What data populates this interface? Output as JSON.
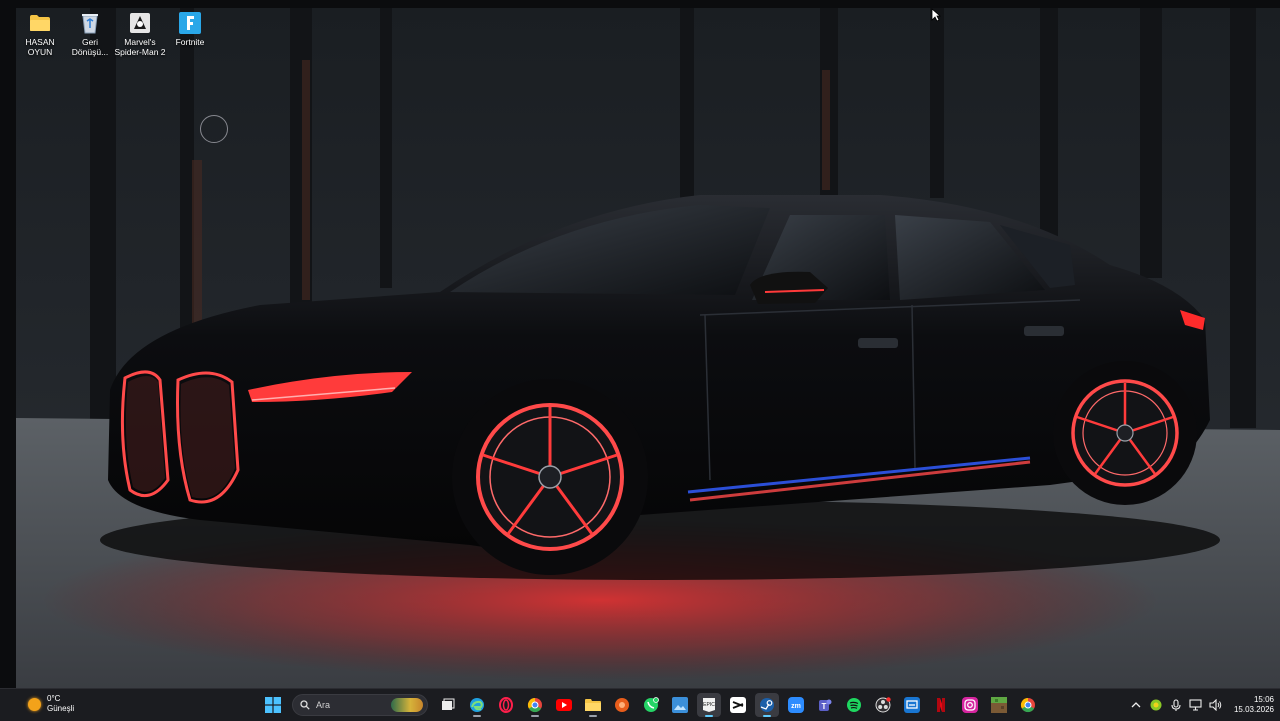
{
  "desktop": {
    "icons": [
      {
        "label": "HASAN\nOYUN",
        "icon": "folder-icon"
      },
      {
        "label": "Geri\nDönüşü...",
        "icon": "recycle-bin-icon"
      },
      {
        "label": "Marvel's\nSpider-Man 2",
        "icon": "spiderman-game-icon"
      },
      {
        "label": "Fortnite",
        "icon": "fortnite-icon"
      }
    ]
  },
  "taskbar": {
    "weather": {
      "temperature": "0°C",
      "condition": "Güneşli",
      "icon": "sun-icon"
    },
    "search_placeholder": "Ara",
    "pinned": [
      "start-icon",
      "search",
      "task-view-icon",
      "edge-icon",
      "opera-gx-icon",
      "chrome-icon",
      "youtube-icon",
      "file-explorer-icon",
      "game-launcher-icon",
      "whatsapp-icon",
      "photos-icon",
      "epic-games-icon",
      "capcut-icon",
      "steam-icon",
      "zoom-icon",
      "teams-icon",
      "spotify-icon",
      "obs-icon",
      "remote-desktop-icon",
      "netflix-icon",
      "instagram-icon",
      "minecraft-icon",
      "chrome-canary-icon"
    ],
    "tray": {
      "icons": [
        "chevron-up-icon",
        "nvidia-icon",
        "microphone-icon",
        "network-icon",
        "volume-icon"
      ],
      "time": "15:06",
      "date": "15.03.2026"
    }
  },
  "colors": {
    "taskbar_bg": "#1b1c20",
    "accent": "#60cdff",
    "glow": "#ff3b3b"
  }
}
